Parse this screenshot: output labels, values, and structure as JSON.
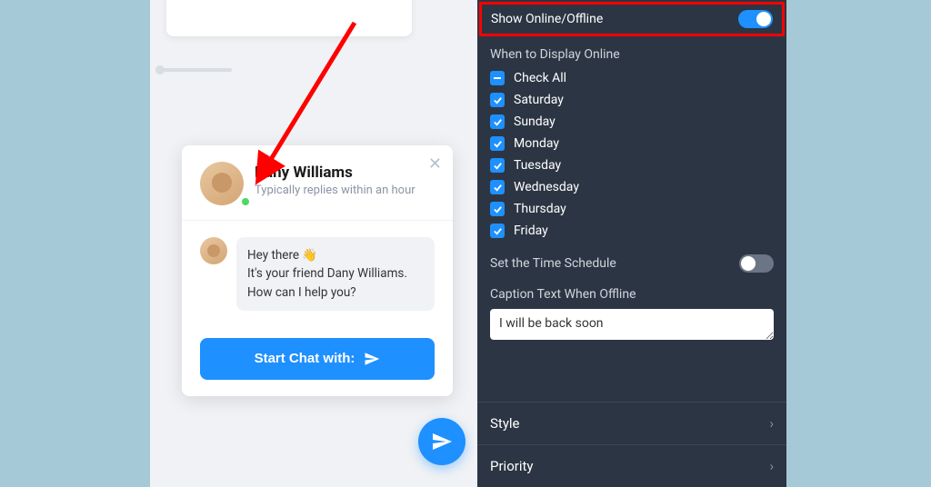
{
  "chat": {
    "agent_name": "Dany Williams",
    "reply_time": "Typically replies within an hour",
    "greeting_line1": "Hey there 👋",
    "greeting_line2": "It's your friend Dany Williams. How can I help you?",
    "start_button": "Start Chat with:"
  },
  "settings": {
    "show_online_label": "Show Online/Offline",
    "show_online_on": true,
    "when_display_label": "When to Display Online",
    "check_all_label": "Check All",
    "days": [
      {
        "label": "Saturday",
        "checked": true
      },
      {
        "label": "Sunday",
        "checked": true
      },
      {
        "label": "Monday",
        "checked": true
      },
      {
        "label": "Tuesday",
        "checked": true
      },
      {
        "label": "Wednesday",
        "checked": true
      },
      {
        "label": "Thursday",
        "checked": true
      },
      {
        "label": "Friday",
        "checked": true
      }
    ],
    "time_schedule_label": "Set the Time Schedule",
    "time_schedule_on": false,
    "caption_label": "Caption Text When Offline",
    "caption_value": "I will be back soon",
    "style_label": "Style",
    "priority_label": "Priority"
  },
  "colors": {
    "accent": "#1e90ff",
    "highlight": "#ff0000"
  }
}
